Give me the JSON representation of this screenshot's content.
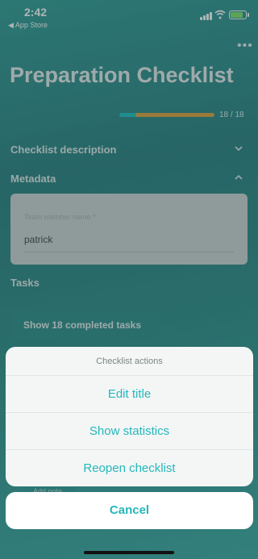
{
  "status_bar": {
    "time": "2:42",
    "back_app": "◀ App Store"
  },
  "header": {
    "title": "Preparation Checklist",
    "more_icon": "ellipsis-icon"
  },
  "progress": {
    "text": "18 / 18",
    "completed": 18,
    "total": 18,
    "track_color": "#1bc0bf",
    "bar_color": "#e1a13a"
  },
  "sections": {
    "description": "Checklist description",
    "metadata": "Metadata",
    "tasks": "Tasks"
  },
  "metadata": {
    "field_placeholder": "Team member name *",
    "field_value": "patrick"
  },
  "tasks": {
    "show_completed_label": "Show 18 completed tasks",
    "add_note_label": "Add note"
  },
  "action_sheet": {
    "title": "Checklist actions",
    "items": [
      "Edit title",
      "Show statistics",
      "Reopen checklist"
    ],
    "cancel_label": "Cancel",
    "accent_color": "#25b7ba"
  }
}
